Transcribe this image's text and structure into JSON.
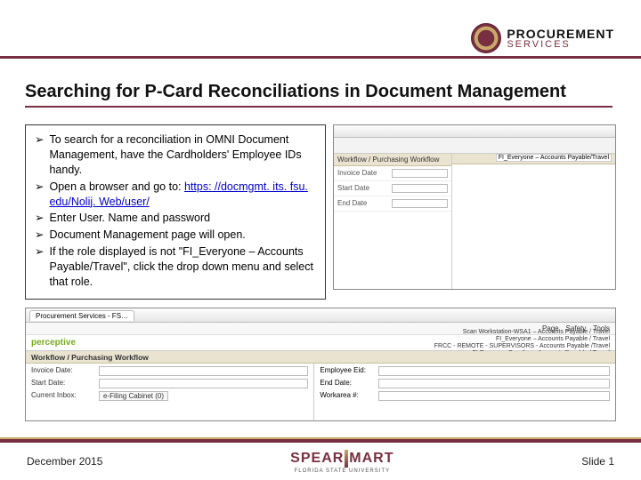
{
  "header": {
    "brand_top": "PROCUREMENT",
    "brand_bottom": "SERVICES"
  },
  "title": "Searching for P-Card Reconciliations in Document Management",
  "bullets": {
    "items": [
      {
        "text": "To search for a reconciliation in OMNI Document Management, have the Cardholders'  Employee IDs handy."
      },
      {
        "text_prefix": "Open a browser and go to: ",
        "link": "https: //docmgmt. its. fsu. edu/Nolij. Web/user/"
      },
      {
        "text": "Enter User. Name and password"
      },
      {
        "text": "Document Management page will open."
      },
      {
        "text": "If the role displayed is not \"FI_Everyone – Accounts Payable/Travel\", click the drop down menu and select that role."
      }
    ],
    "arrow_glyph": "➢"
  },
  "shot_top": {
    "role_label": "FI_Everyone – Accounts Payable/Travel",
    "workflow_hdr": "Workflow / Purchasing Workflow",
    "fields": {
      "invoice": "Invoice Date",
      "start": "Start Date",
      "end": "End Date"
    }
  },
  "shot_bottom": {
    "tab": "Procurement Services - FS…",
    "menu": {
      "page": "Page",
      "safety": "Safety",
      "tools": "Tools"
    },
    "brand": "perceptive",
    "roles": {
      "r1": "Scan Workstation-WSA1 – Accounts Payable / Travel",
      "r2": "FI_Everyone – Accounts Payable / Travel",
      "r3": "FRCC - REMOTE - SUPERVISORS - Accounts Payable /Travel",
      "r4": "FI Everyone-Garother - Accounts Payable / Travel"
    },
    "workflow_hdr": "Workflow / Purchasing Workflow",
    "form": {
      "invoice": "Invoice Date:",
      "start": "Start Date:",
      "inbox_label": "Current Inbox:",
      "inbox_value": "e-Filing Cabinet (0)",
      "emplid": "Employee Eid:",
      "end": "End Date:",
      "workarea": "Workarea #:"
    }
  },
  "footer": {
    "date": "December 2015",
    "logo_main_left": "SPEAR",
    "logo_main_right": "MART",
    "logo_sub": "FLORIDA STATE UNIVERSITY",
    "slide": "Slide 1"
  }
}
